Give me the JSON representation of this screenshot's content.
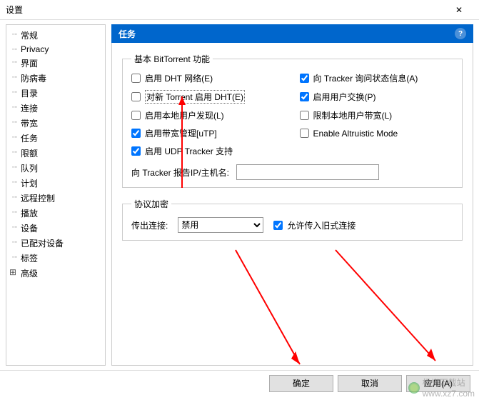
{
  "window": {
    "title": "设置",
    "close": "✕"
  },
  "sidebar": {
    "items": [
      {
        "label": "常规"
      },
      {
        "label": "Privacy"
      },
      {
        "label": "界面"
      },
      {
        "label": "防病毒"
      },
      {
        "label": "目录"
      },
      {
        "label": "连接"
      },
      {
        "label": "带宽"
      },
      {
        "label": "任务",
        "selected": true
      },
      {
        "label": "限额"
      },
      {
        "label": "队列"
      },
      {
        "label": "计划"
      },
      {
        "label": "远程控制"
      },
      {
        "label": "播放"
      },
      {
        "label": "设备"
      },
      {
        "label": "已配对设备"
      },
      {
        "label": "标签"
      },
      {
        "label": "高级",
        "expandable": true
      }
    ]
  },
  "header": {
    "title": "任务",
    "help": "?"
  },
  "groups": {
    "basic": {
      "legend": "基本 BitTorrent 功能",
      "dht": {
        "checked": false,
        "label": "启用 DHT 网络(E)"
      },
      "tracker": {
        "checked": true,
        "label": "向 Tracker 询问状态信息(A)"
      },
      "dhtNew": {
        "checked": false,
        "label": "对新 Torrent 启用 DHT(E)",
        "highlighted": true
      },
      "pex": {
        "checked": true,
        "label": "启用用户交换(P)"
      },
      "lpd": {
        "checked": false,
        "label": "启用本地用户发现(L)"
      },
      "limitLocal": {
        "checked": false,
        "label": "限制本地用户带宽(L)"
      },
      "utp": {
        "checked": true,
        "label": "启用带宽管理[uTP]"
      },
      "altruistic": {
        "checked": false,
        "label": "Enable Altruistic Mode"
      },
      "udpTracker": {
        "checked": true,
        "label": "启用 UDP Tracker 支持"
      },
      "ipLabel": "向 Tracker 报告IP/主机名:",
      "ipValue": ""
    },
    "encryption": {
      "legend": "协议加密",
      "outLabel": "传出连接:",
      "outValue": "禁用",
      "allowIncoming": {
        "checked": true,
        "label": "允许传入旧式连接"
      }
    }
  },
  "footer": {
    "ok": "确定",
    "cancel": "取消",
    "apply": "应用(A)"
  },
  "watermark": {
    "text": "极光下载站",
    "url": "www.xz7.com"
  }
}
